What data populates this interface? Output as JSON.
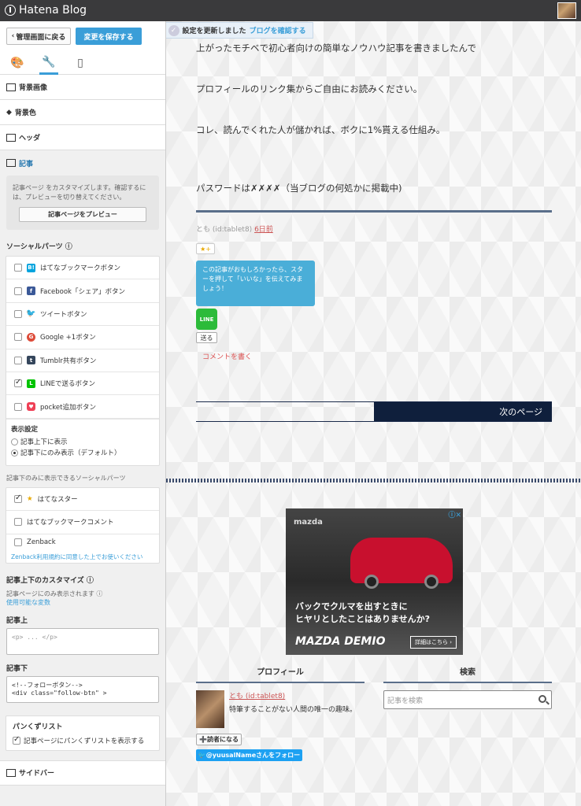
{
  "app": {
    "brand": "Hatena Blog"
  },
  "sidebar": {
    "back_label": "管理画面に戻る",
    "save_label": "変更を保存する",
    "sections": {
      "bg_image": "背景画像",
      "bg_color": "背景色",
      "header": "ヘッダ",
      "article": "記事"
    },
    "article_desc": "記事ページ をカスタマイズします。確認するには、プレビューを切り替えてください。",
    "preview_label": "記事ページをプレビュー",
    "social_title": "ソーシャルパーツ",
    "social_items": [
      {
        "label": "はてなブックマークボタン",
        "checked": false
      },
      {
        "label": "Facebook「シェア」ボタン",
        "checked": false
      },
      {
        "label": "ツイートボタン",
        "checked": false
      },
      {
        "label": "Google +1ボタン",
        "checked": false
      },
      {
        "label": "Tumblr共有ボタン",
        "checked": false
      },
      {
        "label": "LINEで送るボタン",
        "checked": true
      },
      {
        "label": "pocket追加ボタン",
        "checked": false
      }
    ],
    "display_title": "表示設定",
    "display_options": [
      "記事上下に表示",
      "記事下にのみ表示（デフォルト）"
    ],
    "below_only_title": "記事下のみに表示できるソーシャルパーツ",
    "below_items": [
      {
        "label": "はてなスター",
        "checked": true
      },
      {
        "label": "はてなブックマークコメント",
        "checked": false
      },
      {
        "label": "Zenback",
        "checked": false
      }
    ],
    "zenback_note": "Zenback利用規約に同意した上でお使いください",
    "custom_title": "記事上下のカスタマイズ",
    "custom_note": "記事ページにのみ表示されます",
    "vars_link": "使用可能な変数",
    "top_label": "記事上",
    "top_value": "<p> ... </p>",
    "bottom_label": "記事下",
    "bottom_value": "<!--フォローボタン-->\n<div class=\"follow-btn\" >",
    "breadcrumb_title": "パンくずリスト",
    "breadcrumb_item": "記事ページにパンくずリストを表示する",
    "sidebar_section": "サイドバー"
  },
  "toast": {
    "message": "設定を更新しました",
    "link": "ブログを確認する"
  },
  "article": {
    "lines": [
      "上がったモチベで初心者向けの簡単なノウハウ記事を書きましたんで",
      "プロフィールのリンク集からご自由にお読みください。",
      "コレ、読んでくれた人が儲かれば、ボクに1%貰える仕組み。",
      "パスワードは✗✗✗✗（当ブログの何処かに掲載中)"
    ],
    "author": "とも (id:tablet8)",
    "ago": "6日前",
    "star_label": "★+",
    "star_tip": "この記事がおもしろかったら、スターを押して「いいな」を伝えてみましょう！",
    "line_label": "LINE",
    "send_label": "送る",
    "comment_label": "コメントを書く",
    "next_label": "次のページ"
  },
  "ad": {
    "brand": "mazda",
    "copy_line1": "バックでクルマを出すときに",
    "copy_line2": "ヒヤリとしたことはありませんか?",
    "model": "MAZDA DEMIO",
    "more": "詳細はこちら ›"
  },
  "widgets": {
    "profile_title": "プロフィール",
    "search_title": "検索",
    "profile_name": "とも (id:tablet8)",
    "profile_desc": "特筆することがない人間の唯一の趣味。",
    "reader_label": "読者になる",
    "follow_label": "@yuusalNameさんをフォロー",
    "search_placeholder": "記事を検索"
  }
}
